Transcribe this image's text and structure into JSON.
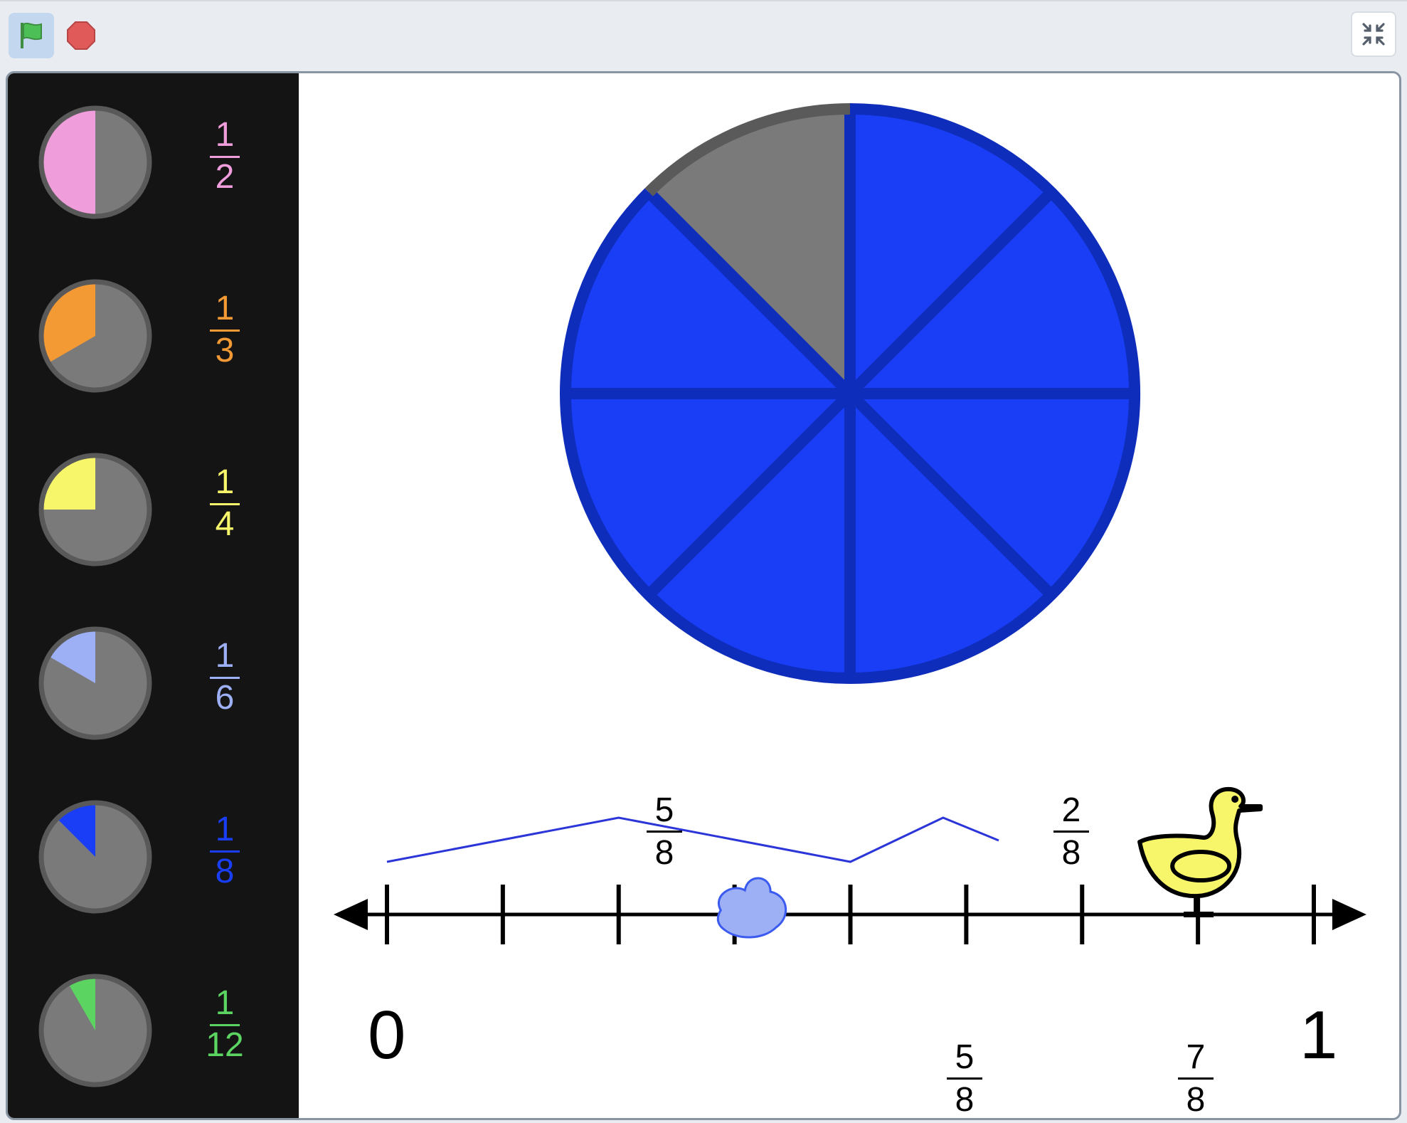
{
  "toolbar": {
    "flag_icon": "green-flag-icon",
    "stop_icon": "stop-icon",
    "fullscreen_icon": "exit-fullscreen-icon",
    "flag_color": "#4cbf56",
    "stop_color": "#e05a5a"
  },
  "palette": {
    "items": [
      {
        "numerator": "1",
        "denominator": "2",
        "color": "#f09ddc",
        "fraction": 0.5
      },
      {
        "numerator": "1",
        "denominator": "3",
        "color": "#f39a35",
        "fraction": 0.3333
      },
      {
        "numerator": "1",
        "denominator": "4",
        "color": "#f7f56a",
        "fraction": 0.25
      },
      {
        "numerator": "1",
        "denominator": "6",
        "color": "#9db0f5",
        "fraction": 0.1667
      },
      {
        "numerator": "1",
        "denominator": "8",
        "color": "#193ef5",
        "fraction": 0.125
      },
      {
        "numerator": "1",
        "denominator": "12",
        "color": "#5bd462",
        "fraction": 0.0833
      }
    ]
  },
  "pie": {
    "slices": 8,
    "filled": 7,
    "fill_color": "#193ef5",
    "line_color": "#0f2dbb",
    "empty_color": "#7a7a7a"
  },
  "jumps": [
    {
      "numerator": "5",
      "denominator": "8"
    },
    {
      "numerator": "2",
      "denominator": "8"
    }
  ],
  "number_line": {
    "start_label": "0",
    "end_label": "1",
    "marked": [
      {
        "numerator": "5",
        "denominator": "8"
      },
      {
        "numerator": "7",
        "denominator": "8"
      }
    ],
    "duck_position": 0.875,
    "puddle_position": 0.4
  }
}
